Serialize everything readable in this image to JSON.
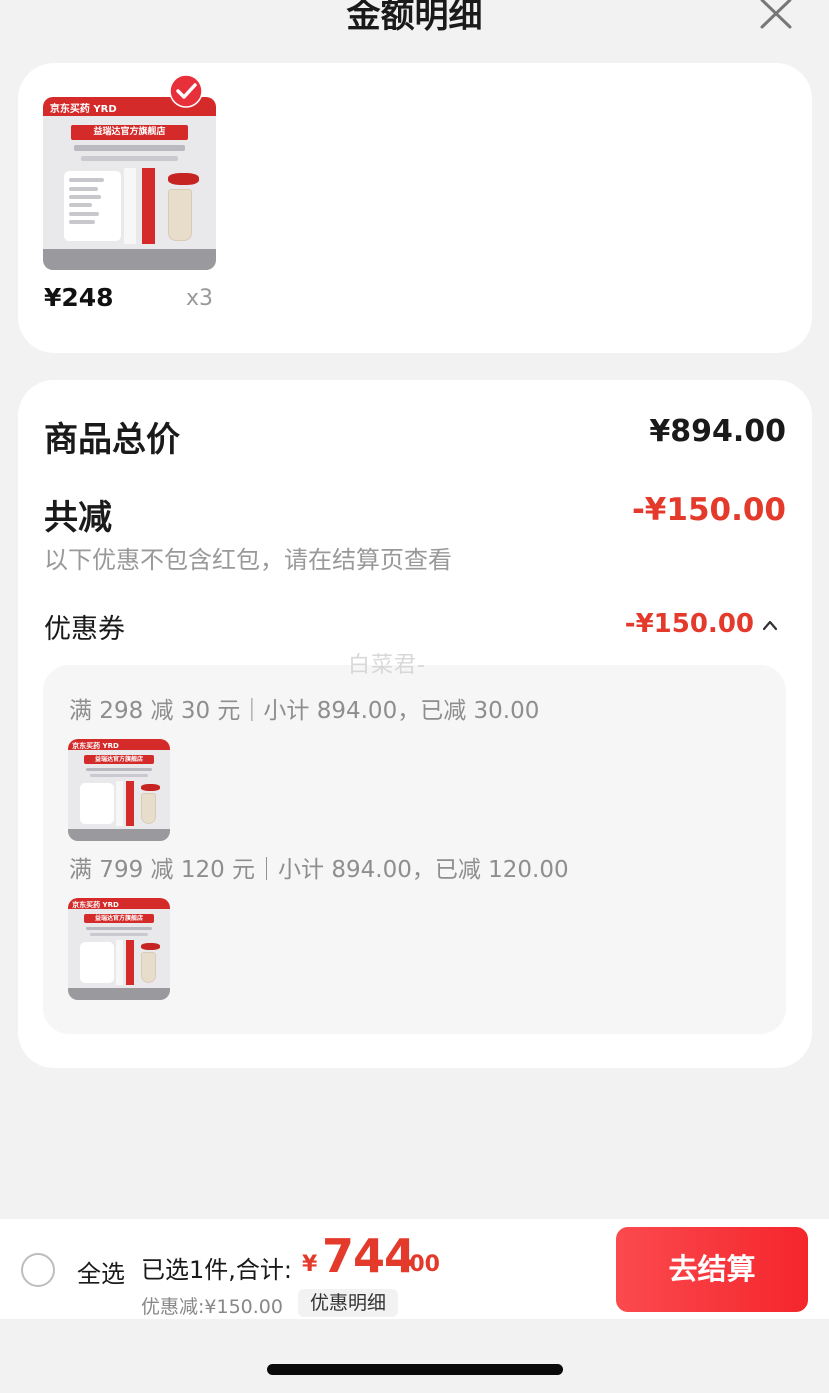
{
  "header": {
    "title": "金额明细"
  },
  "product": {
    "store_tag": "京东买药",
    "brand": "YRD",
    "banner": "益瑞达官方旗舰店",
    "price": "¥248",
    "quantity": "x3",
    "selected": true
  },
  "summary": {
    "total_label": "商品总价",
    "total_value": "¥894.00",
    "discount_label": "共减",
    "discount_value": "-¥150.00",
    "discount_note": "以下优惠不包含红包，请在结算页查看",
    "coupon_label": "优惠券",
    "coupon_value": "-¥150.00"
  },
  "watermark": "白菜君-",
  "coupon_rules": [
    {
      "text": "满 298 减 30 元｜小计 894.00，已减 30.00"
    },
    {
      "text": "满 799 减 120 元｜小计 894.00，已减 120.00"
    }
  ],
  "bottom_bar": {
    "select_all": "全选",
    "selected_text": "已选1件,合计:",
    "amount_symbol": "¥",
    "amount_main": "744",
    "amount_decimal": ".00",
    "saved": "优惠减:¥150.00",
    "detail_chip": "优惠明细",
    "checkout": "去结算"
  },
  "colors": {
    "accent_red": "#e33a2b",
    "button_gradient_start": "#fb4a4f",
    "button_gradient_end": "#f4262c",
    "background": "#f2f2f2"
  }
}
